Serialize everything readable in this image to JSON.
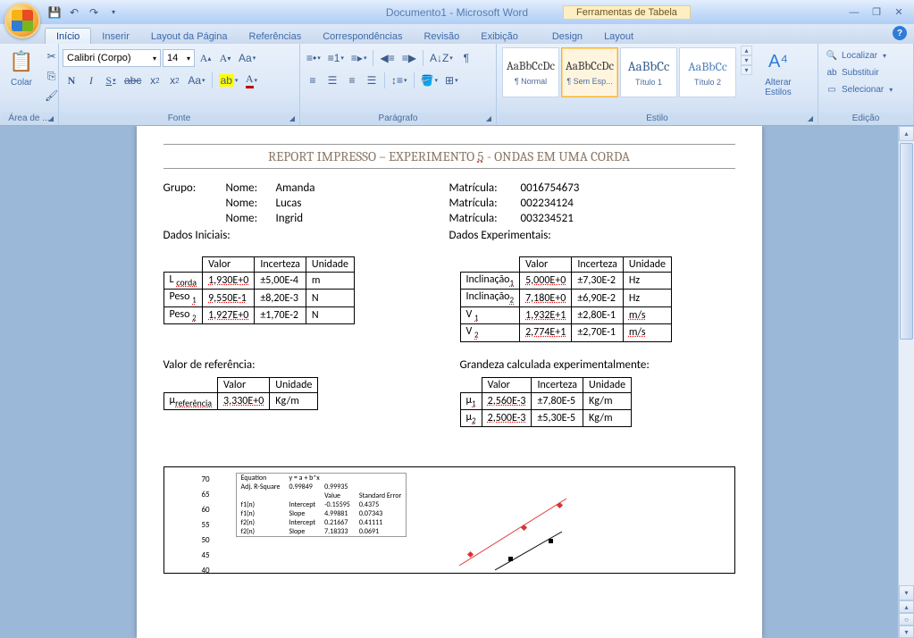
{
  "title": "Documento1 - Microsoft Word",
  "tabletools": "Ferramentas de Tabela",
  "tabs": {
    "inicio": "Início",
    "inserir": "Inserir",
    "layoutpagina": "Layout da Página",
    "referencias": "Referências",
    "correspondencias": "Correspondências",
    "revisao": "Revisão",
    "exibicao": "Exibição",
    "design": "Design",
    "layout": "Layout"
  },
  "groups": {
    "area": "Área de ...",
    "fonte": "Fonte",
    "paragrafo": "Parágrafo",
    "estilo": "Estilo",
    "edicao": "Edição"
  },
  "clipboard": {
    "paste": "Colar"
  },
  "font": {
    "name": "Calibri (Corpo)",
    "size": "14"
  },
  "styles": {
    "normal": "¶ Normal",
    "semespac": "¶ Sem Esp...",
    "titulo1": "Título 1",
    "titulo2": "Título 2",
    "changeStyles": "Alterar\nEstilos"
  },
  "editing": {
    "localizar": "Localizar",
    "substituir": "Substituir",
    "selecionar": "Selecionar"
  },
  "doc": {
    "title_pre": "REPORT IMPRESSO – EXPERIMENTO ",
    "title_num": "5",
    "title_post": " - ONDAS EM UMA CORDA",
    "grupo": "Grupo:",
    "nome": "Nome:",
    "matricula": "Matrícula:",
    "names": [
      "Amanda",
      "Lucas",
      "Ingrid"
    ],
    "mats": [
      "0016754673",
      "002234124",
      "003234521"
    ],
    "dados_iniciais": "Dados Iniciais:",
    "dados_exp": "Dados Experimentais:",
    "headers": {
      "valor": "Valor",
      "incerteza": "Incerteza",
      "unidade": "Unidade"
    },
    "tbl1": [
      {
        "name": "L",
        "sub": "corda",
        "valor": "1,930E+0",
        "inc": "±5,00E-4",
        "unid": "m"
      },
      {
        "name": "Peso",
        "sub": "1",
        "valor": "9,550E-1",
        "inc": "±8,20E-3",
        "unid": "N"
      },
      {
        "name": "Peso",
        "sub": "2",
        "valor": "1,927E+0",
        "inc": "±1,70E-2",
        "unid": "N"
      }
    ],
    "tbl2": [
      {
        "name": "Inclinação",
        "sub": "1",
        "valor": "5,000E+0",
        "inc": "±7,30E-2",
        "unid": "Hz"
      },
      {
        "name": "Inclinação",
        "sub": "2",
        "valor": "7,180E+0",
        "inc": "±6,90E-2",
        "unid": "Hz"
      },
      {
        "name": "V",
        "sub": "1",
        "valor": "1,932E+1",
        "inc": "±2,80E-1",
        "unid": "m/s"
      },
      {
        "name": "V",
        "sub": "2",
        "valor": "2,774E+1",
        "inc": "±2,70E-1",
        "unid": "m/s"
      }
    ],
    "valor_ref": "Valor de referência:",
    "grandeza_calc": "Grandeza calculada experimentalmente:",
    "tbl3": [
      {
        "name": "μ",
        "sub": "referência",
        "valor": "3,330E+0",
        "unid": "Kg/m"
      }
    ],
    "tbl4": [
      {
        "name": "μ",
        "sub": "1",
        "valor": "2,560E-3",
        "inc": "±7,80E-5",
        "unid": "Kg/m"
      },
      {
        "name": "μ",
        "sub": "2",
        "valor": "2,500E-3",
        "inc": "±5,30E-5",
        "unid": "Kg/m"
      }
    ]
  },
  "chart_data": {
    "type": "line",
    "legend_table": {
      "equation": "Equation",
      "eq_val": "y = a + b*x",
      "adj": "Adj. R-Square",
      "adj_vals": [
        "0.99849",
        "0.99935"
      ],
      "cols": [
        "",
        "Value",
        "Standard Error"
      ],
      "rows": [
        [
          "f1(n)",
          "Intercept",
          "-0.15595",
          "0.4375"
        ],
        [
          "f1(n)",
          "Slope",
          "4.99881",
          "0.07343"
        ],
        [
          "f2(n)",
          "Intercept",
          "0.21667",
          "0.41111"
        ],
        [
          "f2(n)",
          "Slope",
          "7.18333",
          "0.0691"
        ]
      ]
    },
    "yticks": [
      "70",
      "65",
      "60",
      "55",
      "50",
      "45",
      "40"
    ]
  }
}
